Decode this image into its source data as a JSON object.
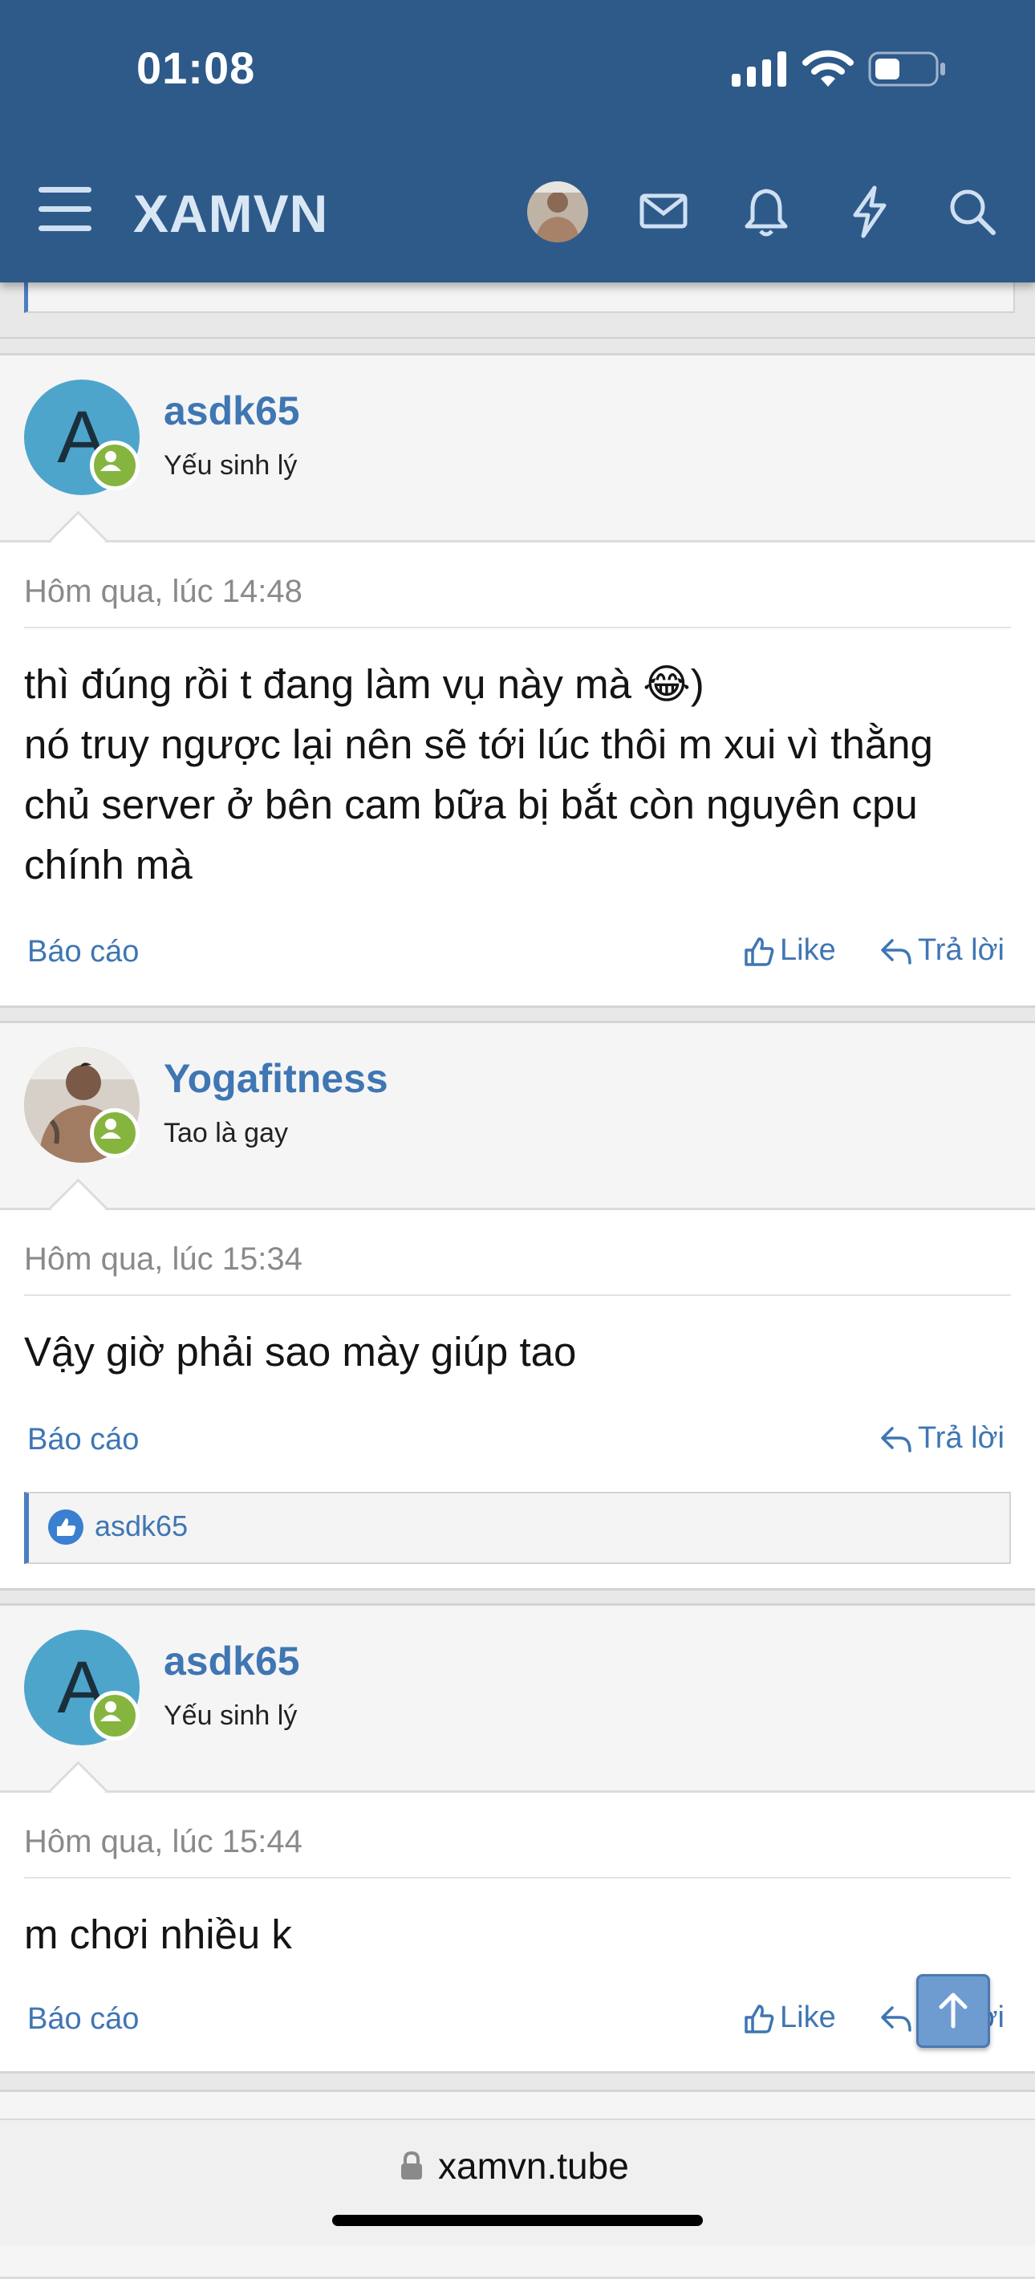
{
  "status_bar": {
    "time": "01:08"
  },
  "header": {
    "logo": "XAMVN",
    "icons": [
      "menu-icon",
      "avatar",
      "mail-icon",
      "bell-icon",
      "lightning-icon",
      "search-icon"
    ]
  },
  "posts": [
    {
      "username": "asdk65",
      "user_title": "Yếu sinh lý",
      "avatar_letter": "A",
      "date": "Hôm qua, lúc 14:48",
      "lines": [
        "thì đúng rồi t đang làm vụ này mà 😂)",
        "nó truy ngược lại nên sẽ tới lúc thôi m xui vì thằng",
        "chủ server ở bên cam bữa bị bắt còn nguyên cpu",
        "chính mà"
      ],
      "report_label": "Báo cáo",
      "like_label": "Like",
      "reply_label": "Trả lời"
    },
    {
      "username": "Yogafitness",
      "user_title": "Tao là gay",
      "date": "Hôm qua, lúc 15:34",
      "lines": [
        "Vậy giờ phải sao mày giúp tao"
      ],
      "report_label": "Báo cáo",
      "reply_label": "Trả lời",
      "reaction_user": "asdk65"
    },
    {
      "username": "asdk65",
      "user_title": "Yếu sinh lý",
      "avatar_letter": "A",
      "date": "Hôm qua, lúc 15:44",
      "lines": [
        "m chơi nhiều k"
      ],
      "report_label": "Báo cáo",
      "like_label": "Like",
      "reply_label": "Trả lời"
    }
  ],
  "browser": {
    "url": "xamvn.tube"
  },
  "colors": {
    "header": "#2e5a8a",
    "link": "#3f76b3",
    "online": "#85b53f"
  }
}
